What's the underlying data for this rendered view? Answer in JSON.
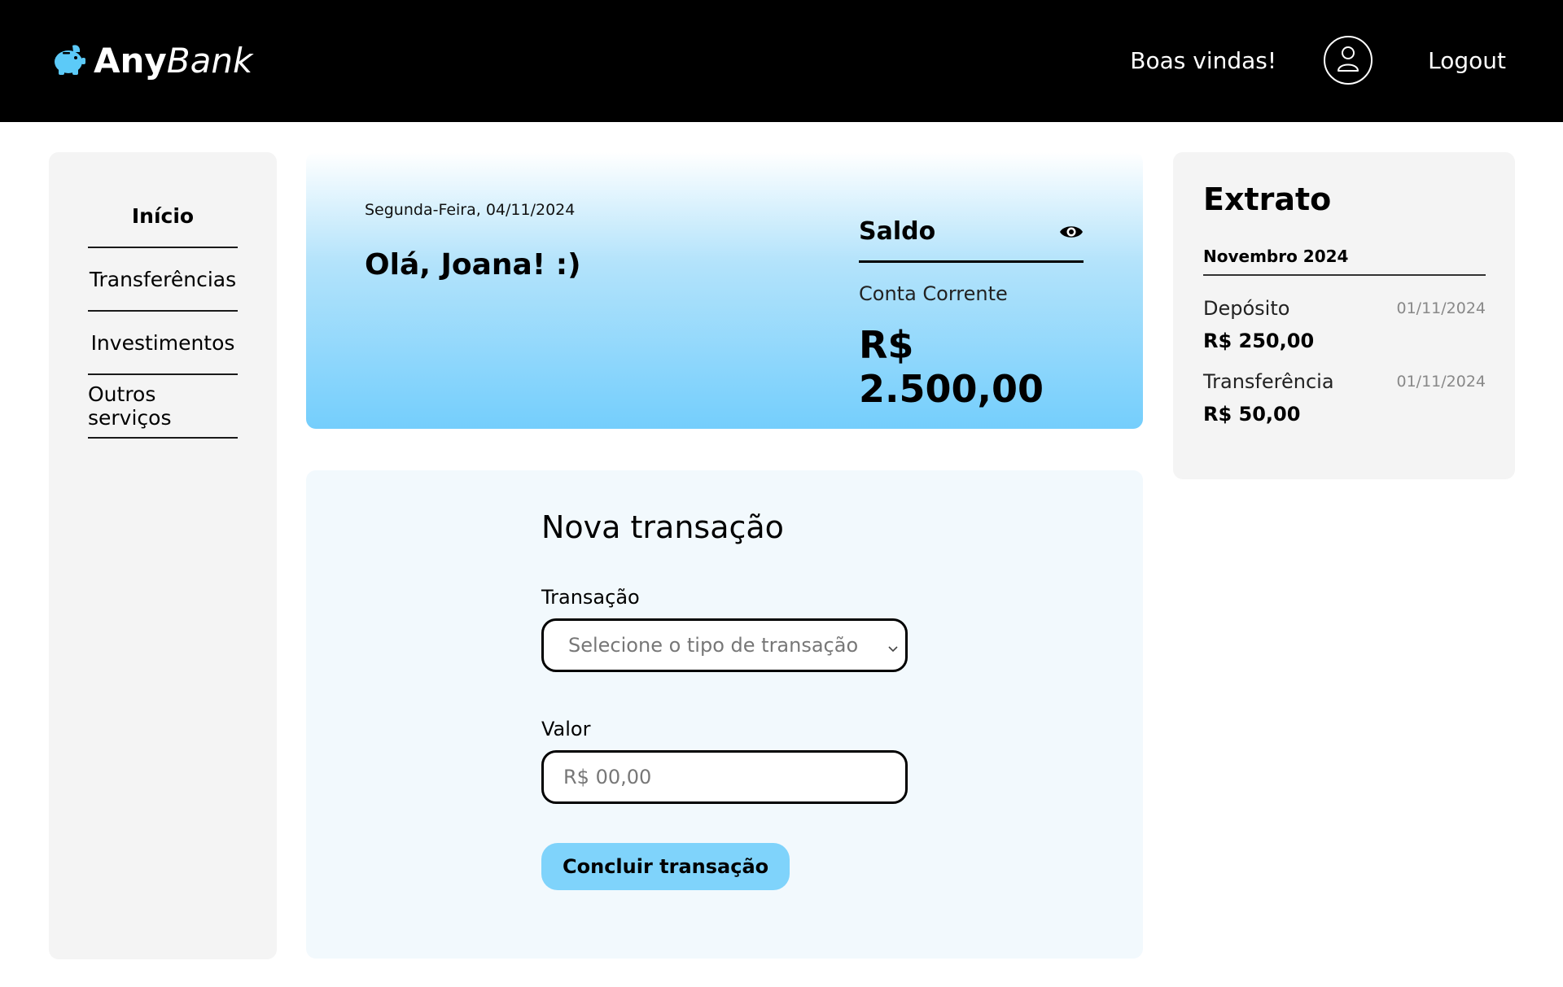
{
  "header": {
    "brand_bold": "Any",
    "brand_light": "Bank",
    "welcome": "Boas vindas!",
    "logout": "Logout",
    "icons": {
      "logo": "piggy-bank-icon",
      "user": "user-icon"
    },
    "colors": {
      "background": "#000000",
      "brand_icon": "#5ccaf8"
    }
  },
  "sidebar": {
    "items": [
      {
        "label": "Início",
        "active": true
      },
      {
        "label": "Transferências",
        "active": false
      },
      {
        "label": "Investimentos",
        "active": false
      },
      {
        "label": "Outros serviços",
        "active": false
      }
    ]
  },
  "summary": {
    "date": "Segunda-Feira, 04/11/2024",
    "greeting": "Olá, Joana! :)",
    "balance_title": "Saldo",
    "account_type": "Conta Corrente",
    "balance": "R$ 2.500,00",
    "icons": {
      "toggle": "eye-icon"
    }
  },
  "transaction": {
    "title": "Nova transação",
    "type_label": "Transação",
    "type_placeholder": "Selecione o tipo de transação",
    "value_label": "Valor",
    "value_placeholder": "R$ 00,00",
    "submit": "Concluir transação",
    "colors": {
      "button": "#7fd3fb"
    }
  },
  "statement": {
    "title": "Extrato",
    "month": "Novembro 2024",
    "entries": [
      {
        "type": "Depósito",
        "date": "01/11/2024",
        "amount": "R$ 250,00"
      },
      {
        "type": "Transferência",
        "date": "01/11/2024",
        "amount": "R$ 50,00"
      }
    ]
  }
}
